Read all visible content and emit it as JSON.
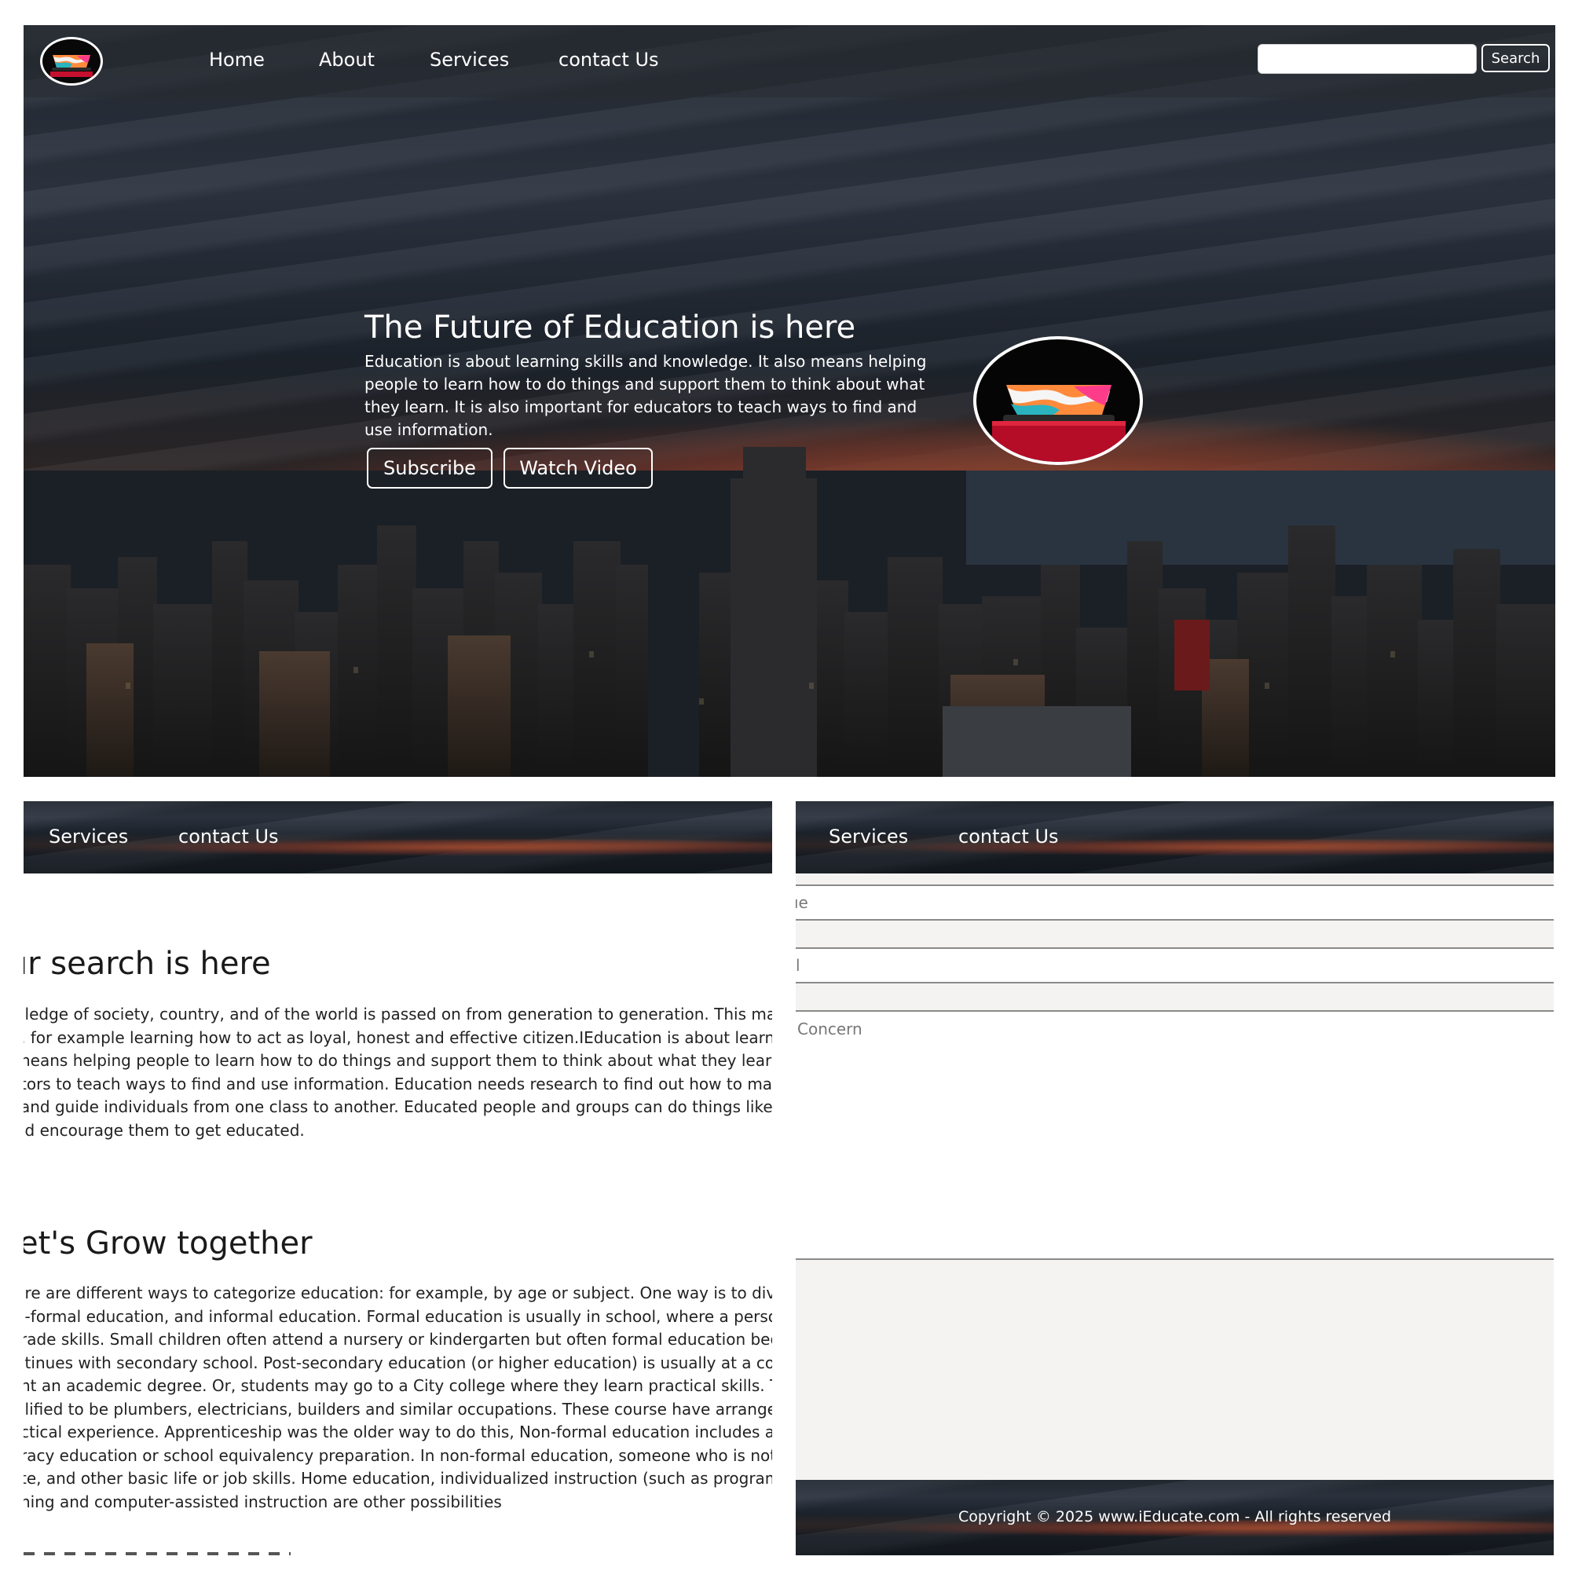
{
  "nav": {
    "home": "Home",
    "about": "About",
    "services": "Services",
    "contact": "contact Us"
  },
  "search": {
    "placeholder": "",
    "button": "Search"
  },
  "hero": {
    "title": "The Future of Education is here",
    "description": "Education is about learning skills and knowledge. It also means helping people to learn how to do things and support them to think about what they learn. It is also important for educators to teach ways to find and use information.",
    "subscribe": "Subscribe",
    "watch_video": "Watch Video"
  },
  "section1": {
    "title": "ır search is here",
    "lines": [
      "ıledge of society, country, and of the world is passed on from generation to generation. This may",
      ", for example learning how to act as loyal, honest and effective citizen.IEducation is about learning",
      "neans helping people to learn how to do things and support them to think about what they learn.",
      "tors to teach ways to find and use information. Education needs research to find out how to make",
      "and guide individuals from one class to another. Educated people and groups can do things like",
      "ıd encourage them to get educated."
    ]
  },
  "section2": {
    "title": "et's Grow together",
    "lines": [
      "ıre are different ways to categorize education: for example, by age or subject. One way is to divide",
      "ı-formal education, and informal education. Formal education is usually in school, where a person r",
      "rade skills. Small children often attend a nursery or kindergarten but often formal education begin",
      "ıtinues with secondary school. Post-secondary education (or higher education) is usually at a colleg",
      "nt an academic degree. Or, students may go to a City college where they learn practical skills. This",
      "ılified to be plumbers, electricians, builders and similar occupations. These course have arrangemer",
      "ctical experience. Apprenticeship was the older way to do this, Non-formal education includes adu",
      "racy education or school equivalency preparation. In non-formal education, someone who is not in",
      "te, and other basic life or job skills. Home education, individualized instruction (such as programme",
      "ning and computer-assisted instruction are other possibilities"
    ]
  },
  "form": {
    "name_placeholder": "ıe",
    "email_placeholder": "l",
    "concern_placeholder": "Concern"
  },
  "footer": {
    "copyright": "Copyright © 2025 www.iEducate.com - All rights reserved"
  }
}
